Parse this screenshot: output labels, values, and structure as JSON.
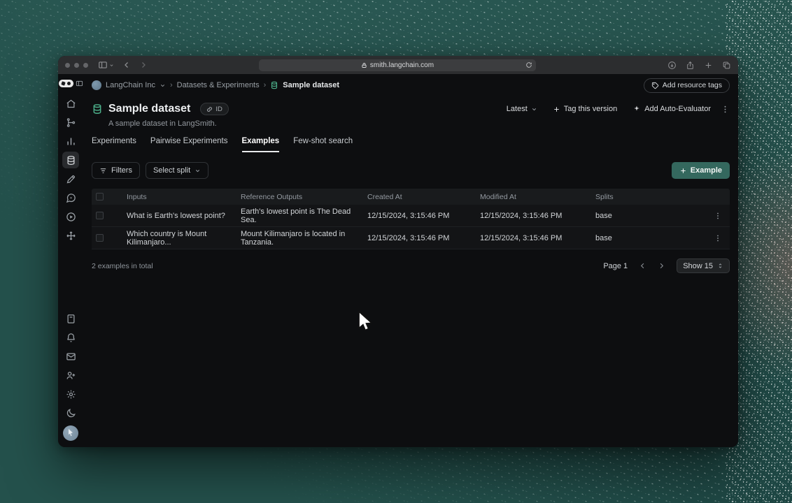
{
  "browser": {
    "url": "smith.langchain.com"
  },
  "breadcrumb": {
    "org": "LangChain Inc",
    "sep": "›",
    "section": "Datasets & Experiments",
    "page": "Sample dataset"
  },
  "header": {
    "add_resource_tags": "Add resource tags"
  },
  "dataset": {
    "title": "Sample dataset",
    "id_badge": "ID",
    "subtitle": "A sample dataset in LangSmith.",
    "version_label": "Latest",
    "tag_version": "Tag this version",
    "add_auto_evaluator": "Add Auto-Evaluator"
  },
  "tabs": [
    {
      "label": "Experiments",
      "active": false
    },
    {
      "label": "Pairwise Experiments",
      "active": false
    },
    {
      "label": "Examples",
      "active": true
    },
    {
      "label": "Few-shot search",
      "active": false
    }
  ],
  "toolbar": {
    "filters": "Filters",
    "select_split": "Select split",
    "add_example": "Example"
  },
  "table": {
    "headers": {
      "inputs": "Inputs",
      "reference_outputs": "Reference Outputs",
      "created_at": "Created At",
      "modified_at": "Modified At",
      "splits": "Splits"
    },
    "rows": [
      {
        "inputs": "What is Earth's lowest point?",
        "reference_outputs": "Earth's lowest point is The Dead Sea.",
        "created_at": "12/15/2024, 3:15:46 PM",
        "modified_at": "12/15/2024, 3:15:46 PM",
        "splits": "base"
      },
      {
        "inputs": "Which country is Mount Kilimanjaro...",
        "reference_outputs": "Mount Kilimanjaro is located in Tanzania.",
        "created_at": "12/15/2024, 3:15:46 PM",
        "modified_at": "12/15/2024, 3:15:46 PM",
        "splits": "base"
      }
    ]
  },
  "pagination": {
    "total": "2 examples in total",
    "page": "Page 1",
    "show": "Show 15"
  },
  "icons": [
    "langsmith-logo",
    "panel-toggle-icon",
    "back-icon",
    "forward-icon",
    "lock-icon",
    "reload-icon",
    "download-icon",
    "share-icon",
    "new-tab-icon",
    "tabs-icon",
    "home-icon",
    "tracing-icon",
    "monitoring-icon",
    "database-icon",
    "pen-icon",
    "feedback-icon",
    "playground-icon",
    "deployments-icon",
    "docs-icon",
    "bell-icon",
    "mail-icon",
    "invite-user-icon",
    "gear-icon",
    "moon-icon",
    "tag-icon",
    "link-icon",
    "sparkle-icon",
    "filter-icon",
    "chevron-down-icon",
    "plus-icon",
    "kebab-icon",
    "checkbox",
    "stepper-icon",
    "arrow-cursor"
  ],
  "colors": {
    "background_teal": "#26524d",
    "accent_button_teal": "#34685e",
    "dataset_icon_green": "#4caf8a",
    "app_background": "#0d0e10",
    "chrome_bar": "#2c2d2f"
  }
}
